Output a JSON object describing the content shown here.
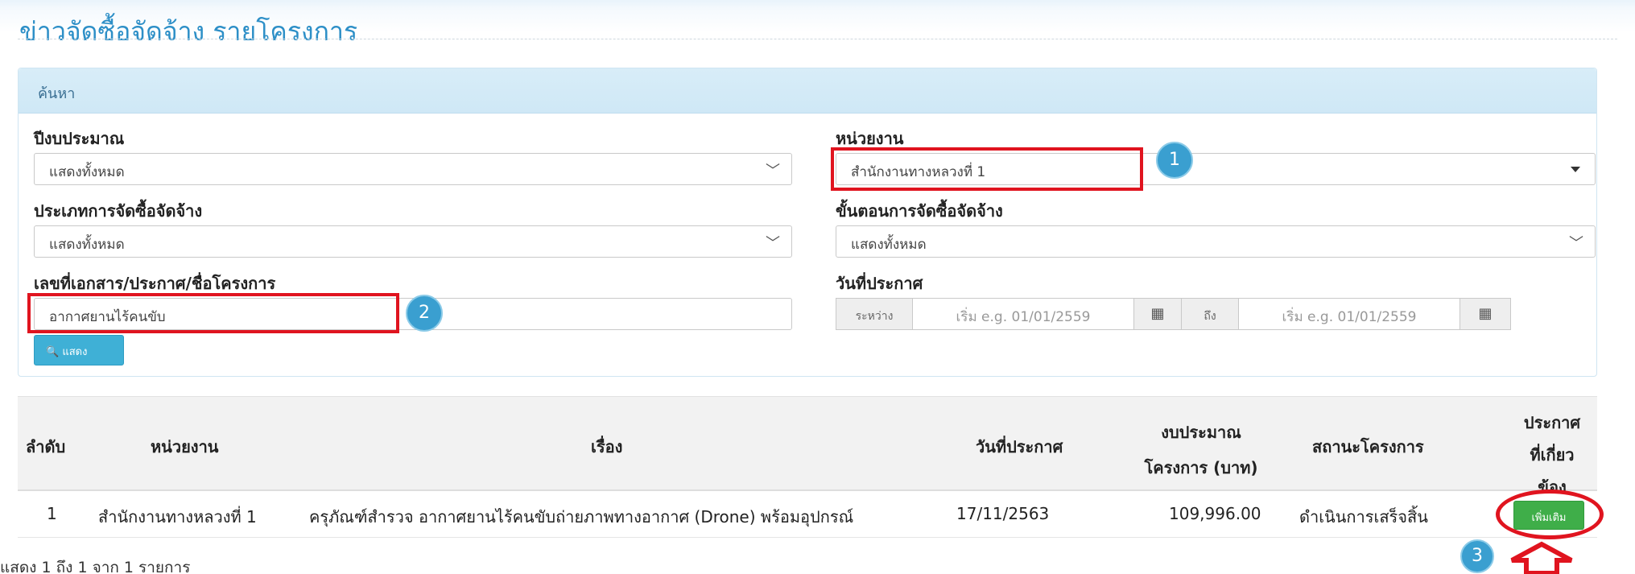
{
  "page": {
    "title": "ข่าวจัดซื้อจัดจ้าง รายโครงการ"
  },
  "search_panel": {
    "heading": "ค้นหา",
    "fiscal_year": {
      "label": "ปีงบประมาณ",
      "value": "แสดงทั้งหมด"
    },
    "agency": {
      "label": "หน่วยงาน",
      "value": "สำนักงานทางหลวงที่ 1"
    },
    "procurement_type": {
      "label": "ประเภทการจัดซื้อจัดจ้าง",
      "value": "แสดงทั้งหมด"
    },
    "procurement_step": {
      "label": "ขั้นตอนการจัดซื้อจัดจ้าง",
      "value": "แสดงทั้งหมด"
    },
    "doc_search": {
      "label": "เลขที่เอกสาร/ประกาศ/ชื่อโครงการ",
      "value": "อากาศยานไร้คนขับ"
    },
    "announce_date": {
      "label": "วันที่ประกาศ",
      "between_label": "ระหว่าง",
      "start_placeholder": "เริ่ม e.g. 01/01/2559",
      "to_label": "ถึง",
      "end_placeholder": "เริ่ม e.g. 01/01/2559"
    },
    "show_button": "แสดง"
  },
  "annotations": {
    "badge1": "1",
    "badge2": "2",
    "badge3": "3"
  },
  "table": {
    "headers": {
      "no": "ลำดับ",
      "agency": "หน่วยงาน",
      "subject": "เรื่อง",
      "announce_date": "วันที่ประกาศ",
      "budget_line1": "งบประมาณ",
      "budget_line2": "โครงการ (บาท)",
      "status": "สถานะโครงการ",
      "related_line1": "ประกาศ",
      "related_line2": "ที่เกี่ยว",
      "related_line3": "ข้อง"
    },
    "rows": [
      {
        "no": "1",
        "agency": "สำนักงานทางหลวงที่ 1",
        "subject": "ครุภัณฑ์สำรวจ อากาศยานไร้คนขับถ่ายภาพทางอากาศ (Drone) พร้อมอุปกรณ์",
        "announce_date": "17/11/2563",
        "budget": "109,996.00",
        "status": "ดำเนินการเสร็จสิ้น",
        "button": "เพิ่มเติม"
      }
    ]
  },
  "footer": {
    "summary": "แสดง 1 ถึง 1 จาก 1 รายการ"
  },
  "colors": {
    "accent": "#3fb0d6",
    "highlight": "#e0141f",
    "success": "#3fae49",
    "title": "#2d8fc7"
  }
}
